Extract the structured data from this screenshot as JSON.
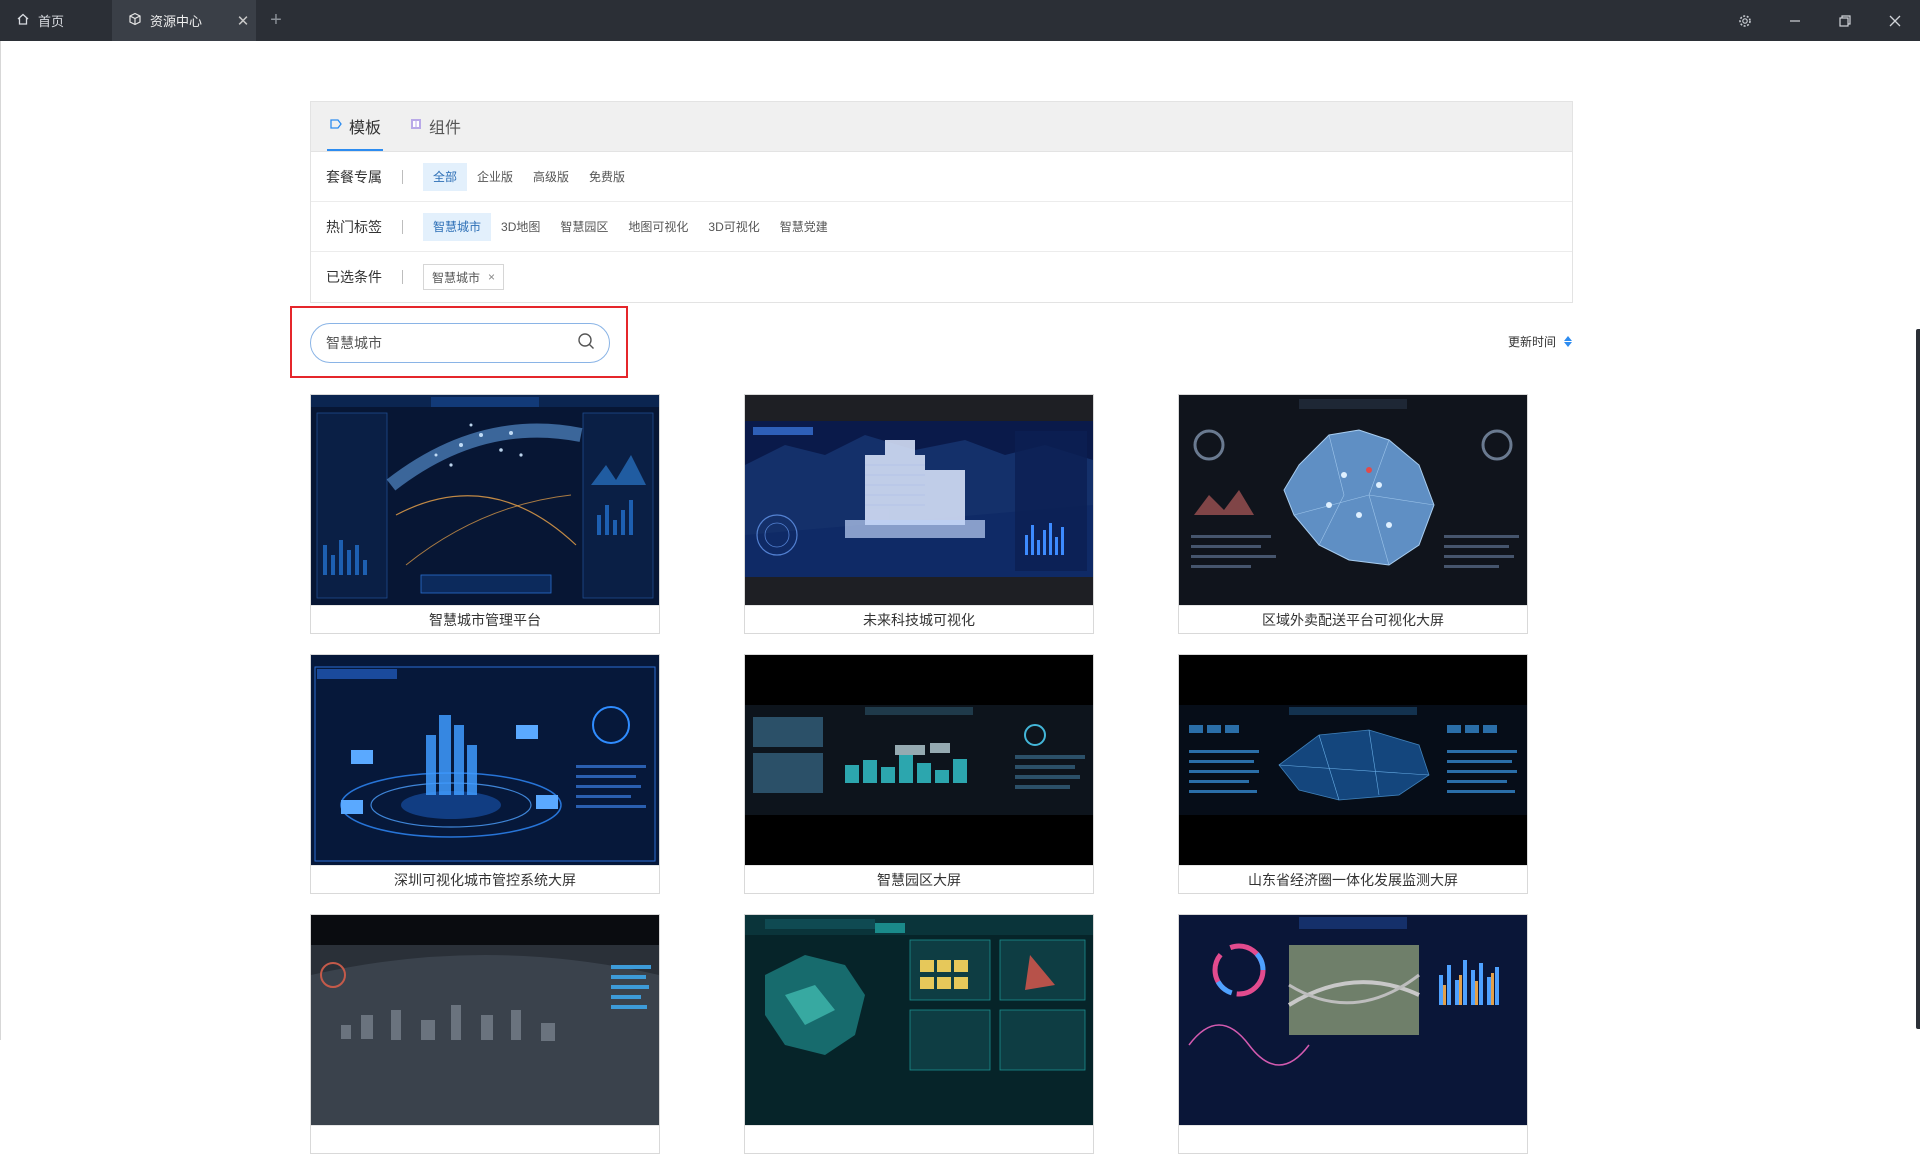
{
  "titlebar": {
    "tabs": [
      {
        "label": "首页",
        "icon": "home-icon"
      },
      {
        "label": "资源中心",
        "icon": "cube-icon",
        "active": true
      }
    ],
    "close_glyph": "✕",
    "add_glyph": "+"
  },
  "filters": {
    "tabs": [
      {
        "label": "模板",
        "icon": "template-icon",
        "active": true
      },
      {
        "label": "组件",
        "icon": "component-icon"
      }
    ],
    "package": {
      "label": "套餐专属",
      "options": [
        "全部",
        "企业版",
        "高级版",
        "免费版"
      ],
      "selected": "全部"
    },
    "hot_tags": {
      "label": "热门标签",
      "options": [
        "智慧城市",
        "3D地图",
        "智慧园区",
        "地图可视化",
        "3D可视化",
        "智慧党建"
      ],
      "selected": "智慧城市"
    },
    "selected_conditions": {
      "label": "已选条件",
      "chips": [
        "智慧城市"
      ],
      "remove_glyph": "×"
    }
  },
  "search": {
    "value": "智慧城市",
    "placeholder": "智慧城市"
  },
  "sort": {
    "label": "更新时间"
  },
  "cards": [
    {
      "title": "智慧城市管理平台"
    },
    {
      "title": "未来科技城可视化"
    },
    {
      "title": "区域外卖配送平台可视化大屏"
    },
    {
      "title": "深圳可视化城市管控系统大屏"
    },
    {
      "title": "智慧园区大屏"
    },
    {
      "title": "山东省经济圈一体化发展监测大屏"
    },
    {
      "title": ""
    },
    {
      "title": ""
    },
    {
      "title": ""
    }
  ],
  "colors": {
    "accent": "#2d8cf0",
    "titlebar": "#2b2f36",
    "highlight_frame": "#e5262b",
    "selected_bg": "#e3f0fc"
  }
}
